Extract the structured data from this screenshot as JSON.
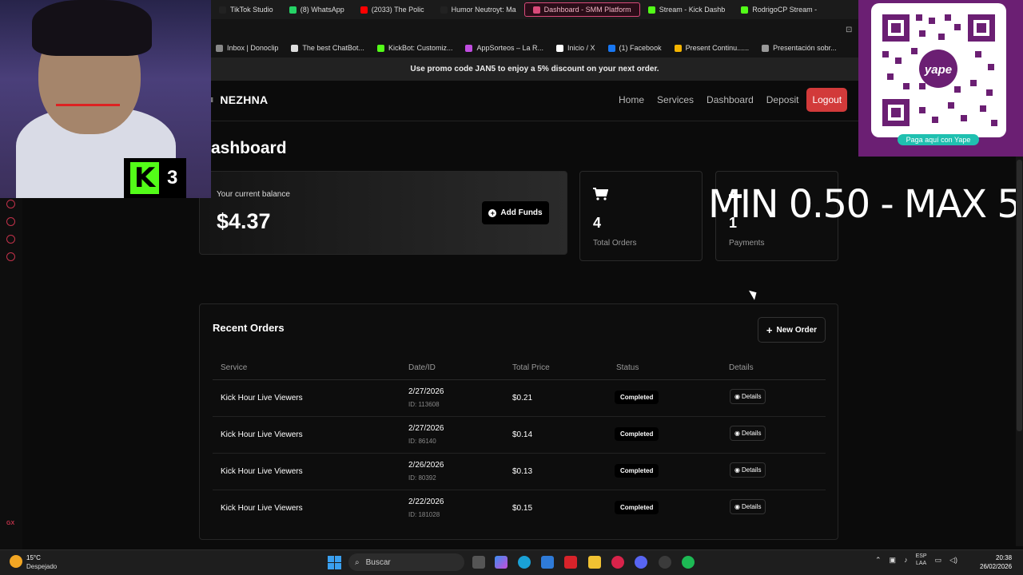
{
  "browser": {
    "tabs": [
      {
        "label": "TikTok Studio",
        "color": "#222",
        "active": false
      },
      {
        "label": "(8) WhatsApp",
        "color": "#25d366",
        "active": false
      },
      {
        "label": "(2033) The Polic",
        "color": "#ff0000",
        "active": false
      },
      {
        "label": "Humor Neutroyt: Ma",
        "color": "#222",
        "active": false
      },
      {
        "label": "Dashboard - SMM Platform",
        "color": "#d94a7a",
        "active": true
      },
      {
        "label": "Stream - Kick Dashb",
        "color": "#53fc18",
        "active": false
      },
      {
        "label": "RodrigoCP Stream -",
        "color": "#53fc18",
        "active": false
      }
    ],
    "bookmarks": [
      {
        "label": "Inbox | Donoclip",
        "color": "#888"
      },
      {
        "label": "The best ChatBot...",
        "color": "#ddd"
      },
      {
        "label": "KickBot: Customiz...",
        "color": "#53fc18"
      },
      {
        "label": "AppSorteos – La R...",
        "color": "#c04de0"
      },
      {
        "label": "Inicio / X",
        "color": "#fff"
      },
      {
        "label": "(1) Facebook",
        "color": "#1877f2"
      },
      {
        "label": "Present Continu......",
        "color": "#f4b400"
      },
      {
        "label": "Presentación sobr...",
        "color": "#999"
      }
    ]
  },
  "promo": {
    "text": "Use promo code JAN5 to enjoy a 5% discount on your next order."
  },
  "site": {
    "brand": "NEZHNA",
    "nav": {
      "home": "Home",
      "services": "Services",
      "dashboard": "Dashboard",
      "deposit": "Deposit",
      "logout": "Logout"
    }
  },
  "dashboard": {
    "title": "ashboard",
    "balance_label": "Your current balance",
    "balance_value": "$4.37",
    "add_funds": "Add Funds",
    "orders_count": "4",
    "orders_label": "Total Orders",
    "payments_count": "1",
    "payments_label": "Payments"
  },
  "overlay": {
    "min_max": "MIN 0.50 - MAX 5"
  },
  "orders": {
    "title": "Recent Orders",
    "new_order": "New Order",
    "headers": {
      "service": "Service",
      "date": "Date/ID",
      "price": "Total Price",
      "status": "Status",
      "details": "Details"
    },
    "rows": [
      {
        "service": "Kick Hour Live Viewers",
        "date": "2/27/2026",
        "id": "ID: 113608",
        "price": "$0.21",
        "status": "Completed",
        "details": "Details"
      },
      {
        "service": "Kick Hour Live Viewers",
        "date": "2/27/2026",
        "id": "ID: 86140",
        "price": "$0.14",
        "status": "Completed",
        "details": "Details"
      },
      {
        "service": "Kick Hour Live Viewers",
        "date": "2/26/2026",
        "id": "ID: 80392",
        "price": "$0.13",
        "status": "Completed",
        "details": "Details"
      },
      {
        "service": "Kick Hour Live Viewers",
        "date": "2/22/2026",
        "id": "ID: 181028",
        "price": "$0.15",
        "status": "Completed",
        "details": "Details"
      }
    ]
  },
  "stream": {
    "kick_viewers": "3",
    "kick_letter": "K",
    "qr_pay": "Paga aquí con Yape"
  },
  "taskbar": {
    "temp": "15°C",
    "weather": "Despejado",
    "search": "Buscar",
    "lang1": "ESP",
    "lang2": "LAA",
    "time": "20:38",
    "date": "26/02/2026"
  }
}
